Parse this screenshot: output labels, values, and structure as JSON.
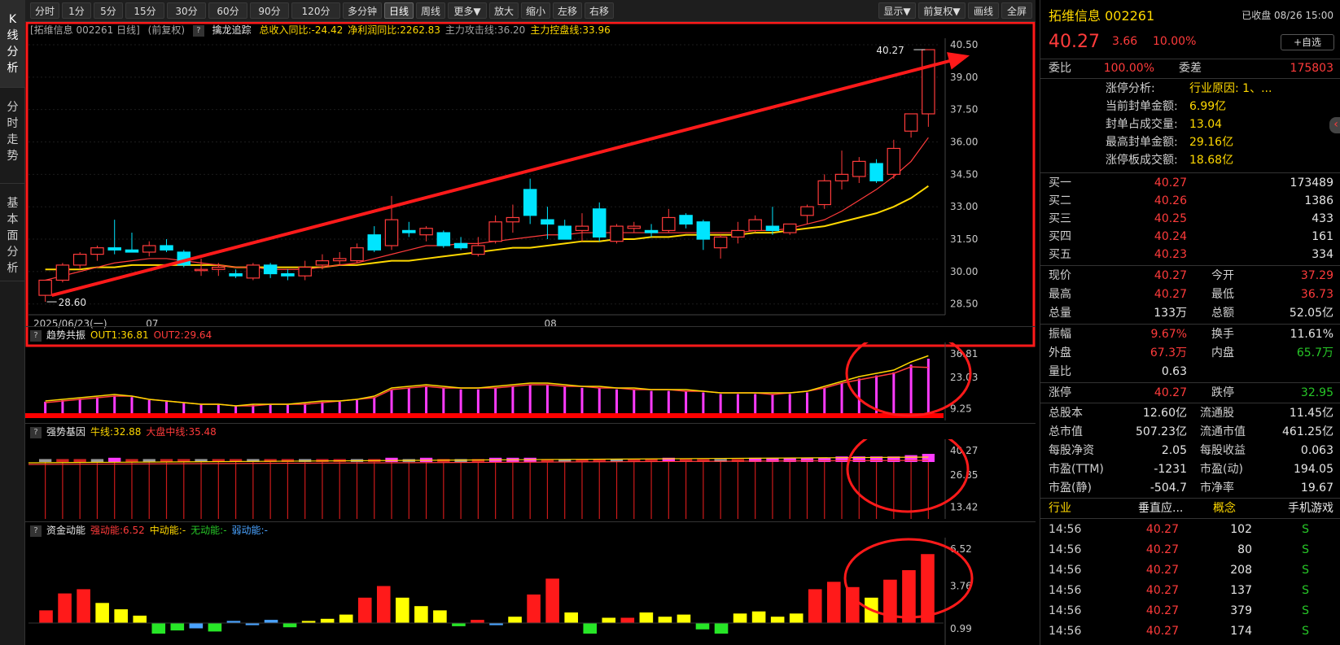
{
  "left_tabs": [
    "K线分析",
    "分时走势",
    "基本面分析"
  ],
  "toolbar": {
    "left": [
      "分时",
      "1分",
      "5分",
      "15分",
      "30分",
      "60分",
      "90分",
      "120分",
      "多分钟",
      "日线",
      "周线",
      "更多▼",
      "放大",
      "缩小",
      "左移",
      "右移"
    ],
    "right": [
      "显示▼",
      "前复权▼",
      "画线",
      "全屏"
    ],
    "active": "日线"
  },
  "main_header": {
    "prefix": "[拓维信息 002261 日线]",
    "mode": "(前复权)",
    "indicator": "擒龙追踪",
    "items": [
      {
        "text": "总收入同比:-24.42",
        "color": "#ffd800"
      },
      {
        "text": "净利润同比:2262.83",
        "color": "#ffd800"
      },
      {
        "text": "主力攻击线:36.20",
        "color": "#a0a0a0"
      },
      {
        "text": "主力控盘线:33.96",
        "color": "#ffd800"
      }
    ]
  },
  "panels": [
    {
      "name": "趋势共振",
      "items": [
        {
          "text": "OUT1:36.81",
          "color": "#ffd800"
        },
        {
          "text": "OUT2:29.64",
          "color": "#ff3b3b"
        }
      ],
      "axis": [
        "36.81",
        "23.03",
        "9.25"
      ]
    },
    {
      "name": "强势基因",
      "items": [
        {
          "text": "牛线:32.88",
          "color": "#ffd800"
        },
        {
          "text": "大盘中线:35.48",
          "color": "#ff3b3b"
        }
      ],
      "axis": [
        "40.27",
        "26.85",
        "13.42"
      ]
    },
    {
      "name": "资金动能",
      "items": [
        {
          "text": "强动能:6.52",
          "color": "#ff3b3b"
        },
        {
          "text": "中动能:-",
          "color": "#ffd800"
        },
        {
          "text": "无动能:-",
          "color": "#27c627"
        },
        {
          "text": "弱动能:-",
          "color": "#4aa3ff"
        }
      ],
      "axis": [
        "6.52",
        "3.76",
        "0.99"
      ]
    }
  ],
  "chart_data": {
    "type": "candlestick",
    "ylim": [
      28.0,
      40.8
    ],
    "y_ticks": [
      "40.50",
      "39.00",
      "37.50",
      "36.00",
      "34.50",
      "33.00",
      "31.50",
      "30.00",
      "28.50"
    ],
    "x_labels": [
      "2025/06/23(一)",
      "07",
      "08"
    ],
    "high_label": "40.27",
    "low_label": "28.60",
    "candles": [
      [
        28.9,
        29.6,
        28.6,
        29.6
      ],
      [
        29.6,
        30.4,
        29.5,
        30.3
      ],
      [
        30.3,
        30.9,
        30.1,
        30.8
      ],
      [
        30.8,
        31.2,
        30.5,
        31.1
      ],
      [
        31.1,
        32.4,
        30.8,
        31.0
      ],
      [
        31.0,
        31.8,
        30.9,
        30.9
      ],
      [
        30.9,
        31.4,
        30.7,
        31.2
      ],
      [
        31.2,
        31.5,
        30.9,
        31.0
      ],
      [
        30.9,
        31.0,
        30.2,
        30.3
      ],
      [
        30.1,
        30.6,
        29.8,
        30.1
      ],
      [
        30.1,
        30.4,
        29.8,
        30.2
      ],
      [
        29.9,
        30.1,
        29.7,
        29.8
      ],
      [
        29.7,
        30.4,
        29.6,
        30.3
      ],
      [
        30.3,
        30.4,
        29.7,
        29.9
      ],
      [
        29.9,
        30.1,
        29.6,
        29.8
      ],
      [
        29.8,
        30.5,
        29.6,
        30.2
      ],
      [
        30.3,
        30.8,
        30.1,
        30.5
      ],
      [
        30.5,
        30.9,
        30.3,
        30.6
      ],
      [
        30.5,
        31.3,
        30.4,
        31.1
      ],
      [
        31.7,
        32.1,
        30.9,
        31.0
      ],
      [
        31.2,
        33.5,
        31.0,
        32.4
      ],
      [
        31.9,
        32.3,
        31.6,
        31.8
      ],
      [
        31.7,
        32.1,
        31.4,
        32.0
      ],
      [
        31.8,
        31.9,
        31.1,
        31.2
      ],
      [
        31.3,
        31.6,
        31.0,
        31.1
      ],
      [
        30.8,
        31.6,
        30.7,
        31.2
      ],
      [
        31.4,
        32.6,
        31.3,
        32.3
      ],
      [
        32.3,
        33.1,
        31.8,
        32.5
      ],
      [
        33.8,
        34.3,
        32.2,
        32.6
      ],
      [
        32.4,
        33.0,
        31.5,
        32.2
      ],
      [
        32.1,
        32.4,
        31.5,
        31.5
      ],
      [
        31.9,
        32.7,
        31.4,
        32.1
      ],
      [
        32.9,
        33.2,
        31.4,
        31.6
      ],
      [
        31.4,
        32.2,
        31.3,
        32.1
      ],
      [
        32.0,
        32.3,
        31.8,
        32.1
      ],
      [
        31.9,
        32.2,
        31.6,
        31.8
      ],
      [
        31.9,
        32.9,
        31.8,
        32.5
      ],
      [
        32.6,
        32.7,
        32.0,
        32.2
      ],
      [
        32.3,
        32.4,
        31.0,
        31.5
      ],
      [
        31.1,
        31.7,
        30.6,
        31.6
      ],
      [
        31.6,
        32.3,
        31.3,
        31.9
      ],
      [
        31.9,
        32.6,
        31.8,
        32.4
      ],
      [
        32.1,
        33.0,
        31.7,
        31.9
      ],
      [
        31.8,
        32.2,
        31.7,
        32.2
      ],
      [
        32.6,
        33.1,
        32.2,
        33.0
      ],
      [
        33.1,
        34.5,
        32.9,
        34.2
      ],
      [
        34.2,
        35.6,
        33.8,
        34.5
      ],
      [
        34.4,
        35.3,
        34.1,
        35.1
      ],
      [
        35.0,
        35.2,
        34.1,
        34.2
      ],
      [
        34.5,
        36.1,
        34.3,
        35.7
      ],
      [
        36.5,
        37.3,
        36.2,
        37.3
      ],
      [
        37.3,
        40.27,
        36.7,
        40.27
      ]
    ],
    "ma_fast": [
      29.6,
      29.8,
      30.0,
      30.2,
      30.4,
      30.5,
      30.6,
      30.6,
      30.5,
      30.4,
      30.3,
      30.2,
      30.2,
      30.1,
      30.1,
      30.1,
      30.2,
      30.3,
      30.4,
      30.6,
      30.8,
      31.0,
      31.2,
      31.2,
      31.3,
      31.3,
      31.4,
      31.5,
      31.6,
      31.7,
      31.7,
      31.8,
      31.8,
      31.8,
      31.8,
      31.8,
      31.8,
      31.8,
      31.8,
      31.8,
      31.8,
      31.9,
      31.9,
      32.0,
      32.2,
      32.4,
      32.8,
      33.3,
      33.8,
      34.4,
      35.1,
      36.2
    ],
    "ma_slow": [
      30.1,
      30.1,
      30.1,
      30.2,
      30.2,
      30.3,
      30.3,
      30.3,
      30.3,
      30.3,
      30.3,
      30.2,
      30.2,
      30.2,
      30.2,
      30.2,
      30.2,
      30.3,
      30.3,
      30.4,
      30.5,
      30.5,
      30.6,
      30.7,
      30.8,
      30.9,
      31.0,
      31.1,
      31.1,
      31.2,
      31.3,
      31.4,
      31.4,
      31.5,
      31.5,
      31.6,
      31.6,
      31.7,
      31.7,
      31.7,
      31.7,
      31.8,
      31.8,
      31.9,
      32.0,
      32.1,
      32.3,
      32.5,
      32.7,
      33.0,
      33.4,
      33.96
    ],
    "trend_out1": [
      9,
      10,
      11,
      12,
      13,
      12,
      10,
      9,
      8,
      7,
      7,
      6,
      7,
      7,
      7,
      8,
      9,
      9,
      10,
      12,
      17,
      18,
      19,
      18,
      17,
      17,
      18,
      19,
      20,
      20,
      19,
      18,
      18,
      17,
      17,
      16,
      16,
      16,
      15,
      14,
      14,
      14,
      14,
      14,
      15,
      18,
      21,
      24,
      26,
      28,
      33,
      36.81
    ],
    "trend_out2": [
      8,
      9,
      10,
      11,
      12,
      12,
      10,
      9,
      8,
      7,
      7,
      6,
      6,
      7,
      7,
      7,
      8,
      9,
      10,
      11,
      16,
      17,
      18,
      17,
      17,
      17,
      17,
      18,
      19,
      19,
      18,
      18,
      17,
      17,
      16,
      16,
      16,
      15,
      15,
      14,
      14,
      14,
      13,
      14,
      15,
      17,
      20,
      22,
      24,
      26,
      30,
      29.64
    ],
    "fund_values": [
      1.2,
      2.8,
      3.2,
      1.9,
      1.3,
      0.7,
      -1.0,
      -0.7,
      -0.5,
      -0.8,
      0.2,
      -0.2,
      0.3,
      -0.4,
      0.2,
      0.4,
      0.8,
      2.4,
      3.5,
      2.4,
      1.6,
      1.2,
      -0.3,
      0.3,
      -0.2,
      0.6,
      2.7,
      4.2,
      1.0,
      -1.0,
      0.5,
      0.5,
      1.0,
      0.6,
      0.8,
      -0.6,
      -1.0,
      0.9,
      1.1,
      0.6,
      0.9,
      3.2,
      3.9,
      3.4,
      2.4,
      4.1,
      5.0,
      6.52
    ],
    "fund_colors": [
      "r",
      "r",
      "r",
      "y",
      "y",
      "y",
      "g",
      "g",
      "b",
      "g",
      "b",
      "b",
      "b",
      "g",
      "y",
      "y",
      "y",
      "r",
      "r",
      "y",
      "y",
      "y",
      "g",
      "r",
      "b",
      "y",
      "r",
      "r",
      "y",
      "g",
      "y",
      "r",
      "y",
      "y",
      "y",
      "g",
      "g",
      "y",
      "y",
      "y",
      "y",
      "r",
      "r",
      "r",
      "y",
      "r",
      "r",
      "r"
    ],
    "gene_bars": [
      1,
      1,
      1,
      1,
      2,
      1,
      1,
      1,
      1,
      1,
      1,
      1,
      1,
      1,
      1,
      1,
      1,
      1,
      1,
      1,
      2,
      1,
      2,
      1,
      1,
      1,
      2,
      2,
      2,
      1,
      1,
      1,
      1,
      1,
      1,
      1,
      2,
      1,
      1,
      1,
      1,
      2,
      2,
      2,
      2,
      2,
      3,
      3,
      3,
      3,
      4,
      5
    ]
  },
  "quote": {
    "title": "拓维信息 002261",
    "status": "已收盘 08/26 15:00",
    "price": "40.27",
    "change": "3.66",
    "pct": "10.00%",
    "add_fav": "+自选"
  },
  "weibi": {
    "label1": "委比",
    "value1": "100.00%",
    "label2": "委差",
    "value2": "175803"
  },
  "limit_up": [
    {
      "label": "涨停分析:",
      "value": "行业原因: 1、..."
    },
    {
      "label": "当前封单金额:",
      "value": "6.99亿"
    },
    {
      "label": "封单占成交量:",
      "value": "13.04"
    },
    {
      "label": "最高封单金额:",
      "value": "29.16亿"
    },
    {
      "label": "涨停板成交额:",
      "value": "18.68亿"
    }
  ],
  "orderbook": [
    {
      "label": "买一",
      "price": "40.27",
      "vol": "173489"
    },
    {
      "label": "买二",
      "price": "40.26",
      "vol": "1386"
    },
    {
      "label": "买三",
      "price": "40.25",
      "vol": "433"
    },
    {
      "label": "买四",
      "price": "40.24",
      "vol": "161"
    },
    {
      "label": "买五",
      "price": "40.23",
      "vol": "334"
    }
  ],
  "stats1": [
    [
      {
        "t": "现价",
        "c": "g"
      },
      {
        "t": "40.27",
        "c": "r"
      },
      {
        "t": "今开",
        "c": "g"
      },
      {
        "t": "37.29",
        "c": "r"
      }
    ],
    [
      {
        "t": "最高",
        "c": "g"
      },
      {
        "t": "40.27",
        "c": "r"
      },
      {
        "t": "最低",
        "c": "g"
      },
      {
        "t": "36.73",
        "c": "r"
      }
    ],
    [
      {
        "t": "总量",
        "c": "g"
      },
      {
        "t": "133万",
        "c": "w"
      },
      {
        "t": "总额",
        "c": "g"
      },
      {
        "t": "52.05亿",
        "c": "w"
      }
    ]
  ],
  "stats2": [
    [
      {
        "t": "振幅",
        "c": "g"
      },
      {
        "t": "9.67%",
        "c": "r"
      },
      {
        "t": "换手",
        "c": "g"
      },
      {
        "t": "11.61%",
        "c": "w"
      }
    ],
    [
      {
        "t": "外盘",
        "c": "g"
      },
      {
        "t": "67.3万",
        "c": "r"
      },
      {
        "t": "内盘",
        "c": "g"
      },
      {
        "t": "65.7万",
        "c": "gr"
      }
    ],
    [
      {
        "t": "量比",
        "c": "g"
      },
      {
        "t": "0.63",
        "c": "w"
      },
      {
        "t": "",
        "c": "g"
      },
      {
        "t": "",
        "c": "w"
      }
    ]
  ],
  "limits": [
    {
      "t": "涨停",
      "c": "g"
    },
    {
      "t": "40.27",
      "c": "r"
    },
    {
      "t": "跌停",
      "c": "g"
    },
    {
      "t": "32.95",
      "c": "gr"
    }
  ],
  "fundamentals": [
    [
      "总股本",
      "12.60亿",
      "流通股",
      "11.45亿"
    ],
    [
      "总市值",
      "507.23亿",
      "流通市值",
      "461.25亿"
    ],
    [
      "每股净资",
      "2.05",
      "每股收益",
      "0.063"
    ],
    [
      "市盈(TTM)",
      "-1231",
      "市盈(动)",
      "194.05"
    ],
    [
      "市盈(静)",
      "-504.7",
      "市净率",
      "19.67"
    ]
  ],
  "industry": {
    "label1": "行业",
    "value1": "垂直应...",
    "label2": "概念",
    "value2": "手机游戏"
  },
  "ticks": [
    {
      "time": "14:56",
      "price": "40.27",
      "vol": "102",
      "side": "S"
    },
    {
      "time": "14:56",
      "price": "40.27",
      "vol": "80",
      "side": "S"
    },
    {
      "time": "14:56",
      "price": "40.27",
      "vol": "208",
      "side": "S"
    },
    {
      "time": "14:56",
      "price": "40.27",
      "vol": "137",
      "side": "S"
    },
    {
      "time": "14:56",
      "price": "40.27",
      "vol": "379",
      "side": "S"
    },
    {
      "time": "14:56",
      "price": "40.27",
      "vol": "174",
      "side": "S"
    }
  ],
  "colors": {
    "up": "#ff3b3b",
    "down": "#00e5ff",
    "ma_fast": "#ff3b3b",
    "ma_slow": "#ffd800",
    "purple": "#ff3bff",
    "annot": "#ff1a1a"
  }
}
